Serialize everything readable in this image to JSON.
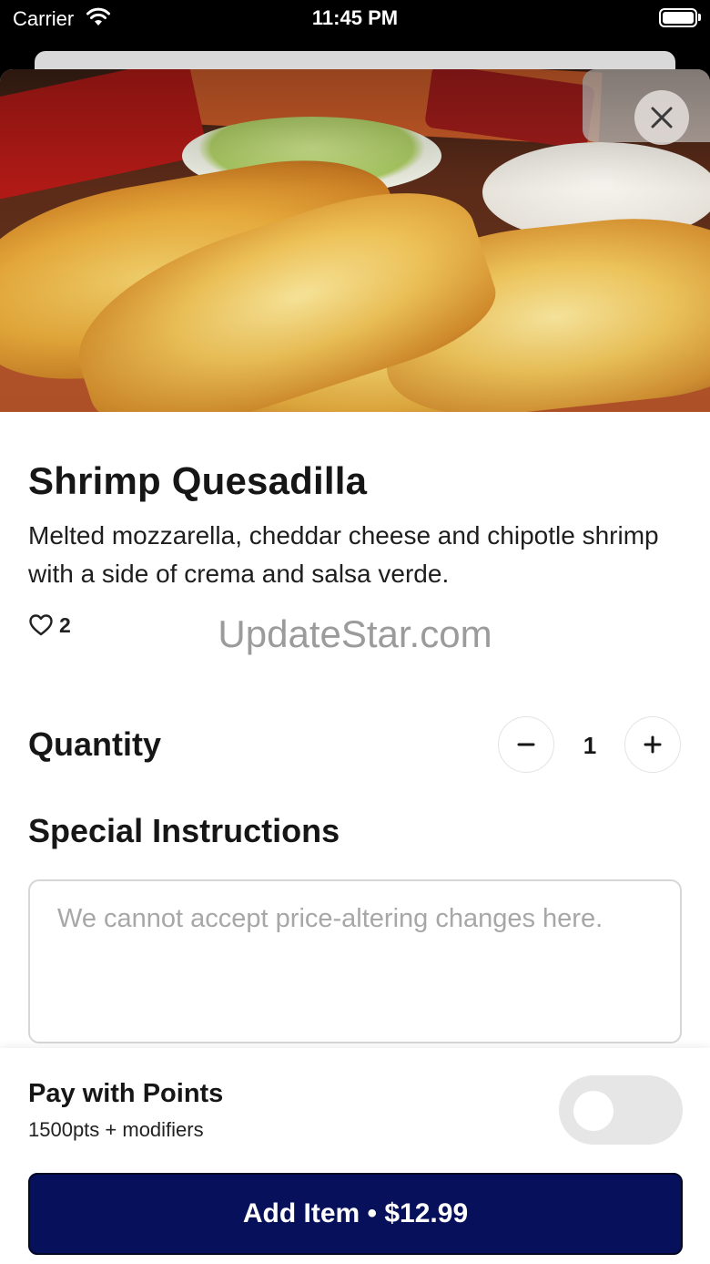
{
  "status_bar": {
    "carrier": "Carrier",
    "time": "11:45 PM"
  },
  "item": {
    "name": "Shrimp Quesadilla",
    "description": "Melted mozzarella, cheddar cheese and chipotle shrimp with a side of crema and salsa verde.",
    "likes": "2"
  },
  "watermark": "UpdateStar.com",
  "quantity": {
    "label": "Quantity",
    "value": "1"
  },
  "instructions": {
    "label": "Special Instructions",
    "placeholder": "We cannot accept price-altering changes here.",
    "value": ""
  },
  "points": {
    "title": "Pay with Points",
    "subtitle": "1500pts + modifiers",
    "enabled": false
  },
  "add_button": {
    "label": "Add Item • $12.99"
  },
  "colors": {
    "primary": "#07105a",
    "toggle_off": "#e6e6e6"
  },
  "icons": [
    "wifi-icon",
    "battery-icon",
    "close-icon",
    "heart-icon",
    "minus-icon",
    "plus-icon"
  ]
}
